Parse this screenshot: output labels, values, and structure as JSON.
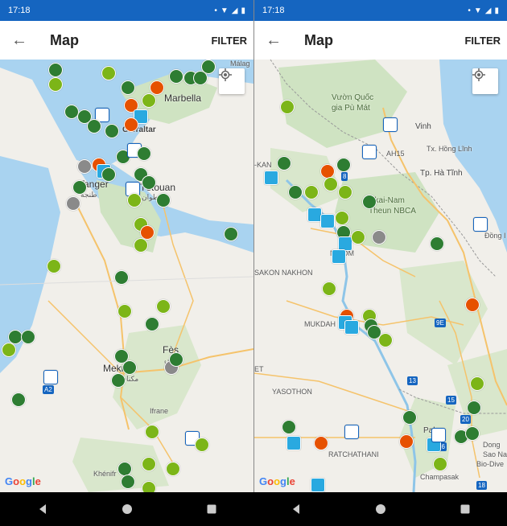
{
  "left": {
    "status": {
      "time": "17:18"
    },
    "appbar": {
      "back_label": "←",
      "title": "Map",
      "filter_label": "FILTER"
    },
    "labels": {
      "marbella": "Marbella",
      "malaga": "Málag",
      "gibraltar": "Gibraltar",
      "tetouan": "Tétouan",
      "tetouan_ar": "تطوان",
      "tanger": "Tanger",
      "tanger_ar": "طنجة",
      "fes": "Fès",
      "fes_ar": "فاس",
      "meknes": "Meknès",
      "meknes_ar": "مكناس",
      "ifrane": "Ifrane",
      "khenifra": "Khénifr",
      "route_a2": "A2"
    }
  },
  "right": {
    "status": {
      "time": "17:18"
    },
    "appbar": {
      "back_label": "←",
      "title": "Map",
      "filter_label": "FILTER"
    },
    "labels": {
      "vuon_quoc": "Vườn Quốc",
      "gia_pu_mat": "gia Pù Mát",
      "vinh": "Vinh",
      "ah15": "AH15",
      "tx_hong_linh": "Tx. Hồng Lĩnh",
      "tp_ha_tinh": "Tp. Hà Tĩnh",
      "nakai_nam": "akai-Nam",
      "theun_nbca": "Theun NBCA",
      "sakon_nakhon": "SAKON NAKHON",
      "mukdahan": "MUKDAH",
      "yasothon": "YASOTHON",
      "ratchathani": "RATCHATHANI",
      "pakse": "Pakse",
      "dong_hoi": "Đồng I",
      "nakhon": "N     NOM",
      "kan": "-KAN",
      "route_9e": "9E",
      "route_13": "13",
      "route_15": "15",
      "route_20": "20",
      "route_16": "16",
      "route_18": "18",
      "route_8": "8",
      "dong_sao": "Dong",
      "sao_nam": "Sao Na",
      "bio_dive": "Bio-Dive",
      "champasak": "Champasak",
      "route_et": "ET"
    }
  },
  "google_text": [
    "G",
    "o",
    "o",
    "g",
    "l",
    "e"
  ],
  "colors": {
    "status_bar": "#1565c0",
    "camp_green": "#2e7d32",
    "camp_lime": "#7cb518",
    "orange": "#e65100",
    "photo_blue": "#29a9e0"
  },
  "icons": {
    "back": "arrow-left-icon",
    "locate": "my-location-icon",
    "camp": "tent-icon",
    "wild": "crescent-moon-icon",
    "photo": "camera-icon",
    "hut": "building-icon",
    "tool": "wrench-icon",
    "nav_back": "triangle-back-icon",
    "nav_home": "circle-home-icon",
    "nav_recents": "square-recents-icon"
  }
}
